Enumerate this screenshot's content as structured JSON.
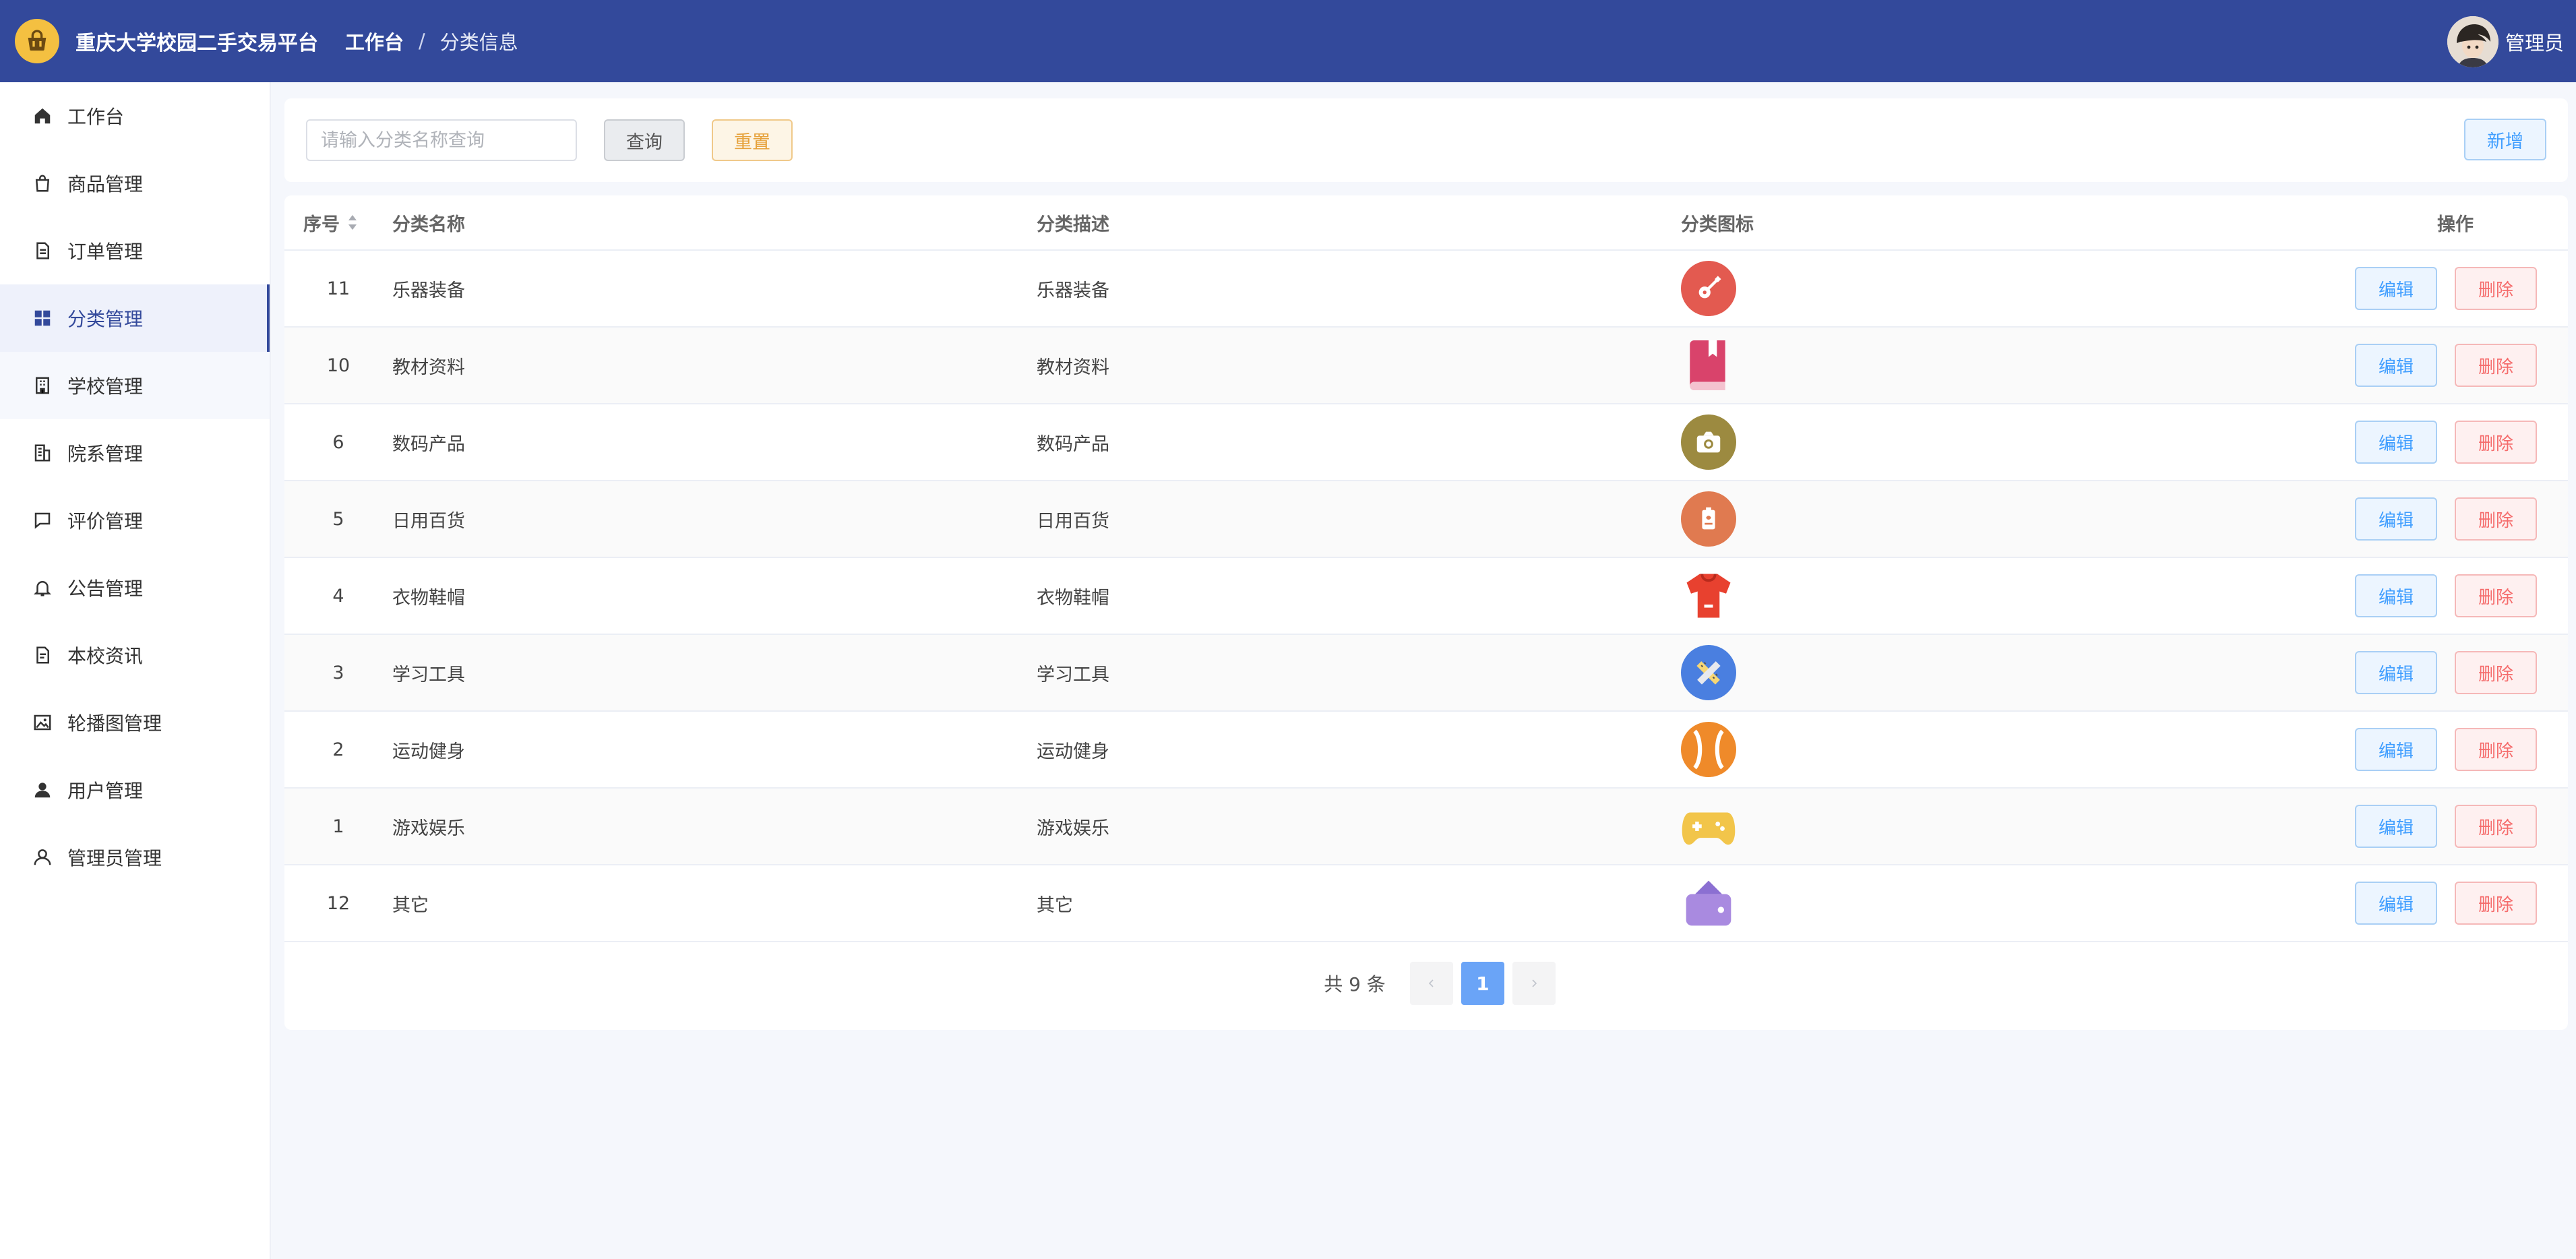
{
  "header": {
    "app_title": "重庆大学校园二手交易平台",
    "breadcrumb": [
      "工作台",
      "分类信息"
    ],
    "user_name": "管理员"
  },
  "sidebar": {
    "items": [
      {
        "label": "工作台",
        "icon": "home-icon"
      },
      {
        "label": "商品管理",
        "icon": "shopping-bag-icon"
      },
      {
        "label": "订单管理",
        "icon": "document-icon"
      },
      {
        "label": "分类管理",
        "icon": "grid-icon",
        "active": true
      },
      {
        "label": "学校管理",
        "icon": "building-icon"
      },
      {
        "label": "院系管理",
        "icon": "office-icon"
      },
      {
        "label": "评价管理",
        "icon": "chat-icon"
      },
      {
        "label": "公告管理",
        "icon": "bell-icon"
      },
      {
        "label": "本校资讯",
        "icon": "news-icon"
      },
      {
        "label": "轮播图管理",
        "icon": "picture-icon"
      },
      {
        "label": "用户管理",
        "icon": "user-filled-icon"
      },
      {
        "label": "管理员管理",
        "icon": "user-icon"
      }
    ]
  },
  "search": {
    "placeholder": "请输入分类名称查询",
    "value": "",
    "query_label": "查询",
    "reset_label": "重置",
    "add_label": "新增"
  },
  "table": {
    "headers": {
      "id": "序号",
      "name": "分类名称",
      "desc": "分类描述",
      "icon": "分类图标",
      "ops": "操作"
    },
    "edit_label": "编辑",
    "delete_label": "删除",
    "rows": [
      {
        "id": "11",
        "name": "乐器装备",
        "desc": "乐器装备",
        "icon": "guitar-icon",
        "color": "#e35a50"
      },
      {
        "id": "10",
        "name": "教材资料",
        "desc": "教材资料",
        "icon": "book-icon",
        "color": "#d9436b"
      },
      {
        "id": "6",
        "name": "数码产品",
        "desc": "数码产品",
        "icon": "camera-icon",
        "color": "#9c8a40"
      },
      {
        "id": "5",
        "name": "日用百货",
        "desc": "日用百货",
        "icon": "tissue-icon",
        "color": "#e07a50"
      },
      {
        "id": "4",
        "name": "衣物鞋帽",
        "desc": "衣物鞋帽",
        "icon": "shirt-icon",
        "color": "#e8412f"
      },
      {
        "id": "3",
        "name": "学习工具",
        "desc": "学习工具",
        "icon": "ruler-pencil-icon",
        "color": "#4a7fe0"
      },
      {
        "id": "2",
        "name": "运动健身",
        "desc": "运动健身",
        "icon": "ball-icon",
        "color": "#ef8a2a"
      },
      {
        "id": "1",
        "name": "游戏娱乐",
        "desc": "游戏娱乐",
        "icon": "gamepad-icon",
        "color": "#f2c54a"
      },
      {
        "id": "12",
        "name": "其它",
        "desc": "其它",
        "icon": "wallet-icon",
        "color": "#a98ae0"
      }
    ]
  },
  "pagination": {
    "total_text": "共 9 条",
    "current_page": "1"
  }
}
